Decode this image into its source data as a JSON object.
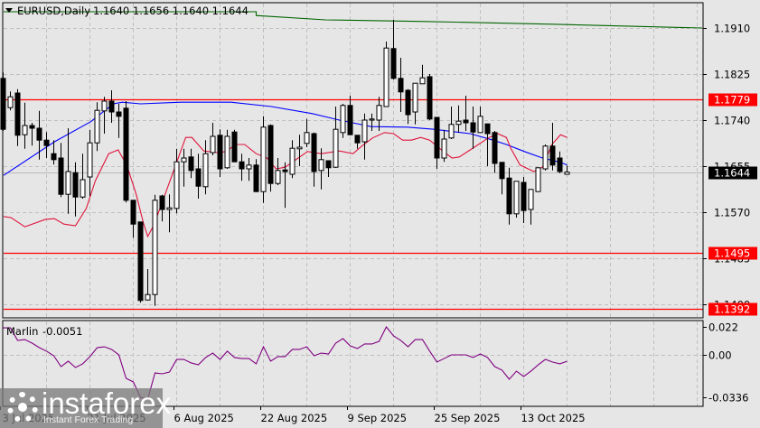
{
  "header": {
    "symbol_timeframe": "EURUSD,Daily",
    "ohlc": "1.1640 1.1656 1.1640 1.1644"
  },
  "price_axis": {
    "ticks": [
      "1.1910",
      "1.1825",
      "1.1740",
      "1.1655",
      "1.1570",
      "1.1485",
      "1.1400"
    ],
    "tick_values": [
      1.191,
      1.1825,
      1.174,
      1.1655,
      1.157,
      1.1485,
      1.14
    ]
  },
  "levels": [
    {
      "label": "1.1779",
      "value": 1.1779,
      "color": "#ff0000"
    },
    {
      "label": "1.1495",
      "value": 1.1495,
      "color": "#ff0000"
    },
    {
      "label": "1.1392",
      "value": 1.1392,
      "color": "#ff0000"
    }
  ],
  "current_price": {
    "label": "1.1644",
    "value": 1.1644
  },
  "date_axis": {
    "labels": [
      "3 Jul 2025",
      "21 Jul 2025",
      "6 Aug 2025",
      "22 Aug 2025",
      "9 Sep 2025",
      "25 Sep 2025",
      "13 Oct 2025"
    ],
    "label_bars": [
      0,
      12,
      24,
      36,
      48,
      60,
      72
    ]
  },
  "indicator": {
    "name": "Marlin",
    "value_label": "-0.0051",
    "ticks": [
      "0.022",
      "0.00",
      "-0.0336"
    ],
    "tick_values": [
      0.022,
      0,
      -0.0336
    ],
    "color": "#800080",
    "values": [
      0.0214,
      0.0214,
      0.0114,
      0.0121,
      0.0093,
      0.0057,
      0.0029,
      -0.0007,
      -0.0093,
      -0.005,
      -0.01,
      -0.0071,
      -0.0014,
      0.0057,
      0.0064,
      0.0043,
      0,
      -0.0186,
      -0.0214,
      -0.0336,
      -0.035,
      -0.0143,
      -0.015,
      -0.0136,
      -0.0036,
      -0.0036,
      -0.0064,
      -0.0079,
      -0.0021,
      0.0014,
      -0.0036,
      0.0029,
      -0.0021,
      -0.0029,
      -0.0029,
      -0.0071,
      0.0064,
      -0.005,
      -0.0014,
      -0.0014,
      0.0043,
      0.0043,
      0.0064,
      -0.0007,
      0.0014,
      0.0007,
      0.0093,
      0.0129,
      0.0071,
      0.005,
      0.0086,
      0.0086,
      0.0107,
      0.0221,
      0.015,
      0.0114,
      0.0064,
      0.0121,
      0.0121,
      0.0029,
      -0.0057,
      -0.0029,
      0,
      0,
      0,
      -0.0021,
      0.0007,
      -0.0021,
      -0.0093,
      -0.0121,
      -0.0193,
      -0.0129,
      -0.0171,
      -0.0129,
      -0.0079,
      -0.0036,
      -0.0057,
      -0.0071,
      -0.0051
    ]
  },
  "watermark": {
    "brand": "instaforex",
    "tagline": "Instant Forex Trading"
  },
  "colors": {
    "bg": "#e6e6e6",
    "grid": "#c0c0c0",
    "fast_ma": "#e0143c",
    "slow_ma": "#0000ff",
    "long_ma": "#006400",
    "level": "#ff0000"
  },
  "chart_data": {
    "type": "candlestick",
    "title": "EURUSD,Daily",
    "ylim": [
      1.138,
      1.1955
    ],
    "candles_ohlc": [
      [
        1.1817,
        1.1828,
        1.172,
        1.1723
      ],
      [
        1.1763,
        1.1793,
        1.1758,
        1.1783
      ],
      [
        1.179,
        1.1797,
        1.1692,
        1.1712
      ],
      [
        1.1713,
        1.1772,
        1.1687,
        1.173
      ],
      [
        1.173,
        1.1735,
        1.1693,
        1.1725
      ],
      [
        1.1725,
        1.1757,
        1.1667,
        1.1703
      ],
      [
        1.1703,
        1.1718,
        1.167,
        1.1693
      ],
      [
        1.1678,
        1.1703,
        1.1658,
        1.1667
      ],
      [
        1.167,
        1.1698,
        1.1598,
        1.1603
      ],
      [
        1.1603,
        1.1725,
        1.1567,
        1.1645
      ],
      [
        1.1643,
        1.1662,
        1.1562,
        1.1598
      ],
      [
        1.1598,
        1.1678,
        1.1595,
        1.163
      ],
      [
        1.1635,
        1.1722,
        1.16,
        1.1698
      ],
      [
        1.1698,
        1.1773,
        1.1683,
        1.1758
      ],
      [
        1.1757,
        1.1783,
        1.1715,
        1.1775
      ],
      [
        1.1775,
        1.1795,
        1.1735,
        1.1755
      ],
      [
        1.1755,
        1.177,
        1.1707,
        1.1747
      ],
      [
        1.1762,
        1.1775,
        1.1588,
        1.1592
      ],
      [
        1.1592,
        1.1592,
        1.1523,
        1.1548
      ],
      [
        1.1552,
        1.1552,
        1.1403,
        1.1407
      ],
      [
        1.1408,
        1.1465,
        1.1407,
        1.1418
      ],
      [
        1.1418,
        1.1602,
        1.1397,
        1.1592
      ],
      [
        1.16,
        1.1602,
        1.1553,
        1.1575
      ],
      [
        1.1575,
        1.1603,
        1.1533,
        1.1578
      ],
      [
        1.1577,
        1.1687,
        1.1568,
        1.1663
      ],
      [
        1.1663,
        1.1687,
        1.1617,
        1.167
      ],
      [
        1.1672,
        1.1687,
        1.1633,
        1.1647
      ],
      [
        1.165,
        1.1678,
        1.1595,
        1.1618
      ],
      [
        1.1617,
        1.1703,
        1.1603,
        1.1678
      ],
      [
        1.168,
        1.1735,
        1.1675,
        1.171
      ],
      [
        1.1712,
        1.1723,
        1.1635,
        1.165
      ],
      [
        1.1652,
        1.1722,
        1.165,
        1.171
      ],
      [
        1.1718,
        1.1722,
        1.1663,
        1.1663
      ],
      [
        1.1663,
        1.1678,
        1.1628,
        1.165
      ],
      [
        1.165,
        1.167,
        1.1628,
        1.1657
      ],
      [
        1.1657,
        1.1668,
        1.1607,
        1.1608
      ],
      [
        1.1608,
        1.1747,
        1.1587,
        1.1727
      ],
      [
        1.173,
        1.1732,
        1.1608,
        1.1623
      ],
      [
        1.1623,
        1.167,
        1.162,
        1.1647
      ],
      [
        1.1648,
        1.1662,
        1.1578,
        1.1645
      ],
      [
        1.164,
        1.1703,
        1.1633,
        1.1688
      ],
      [
        1.1687,
        1.1713,
        1.1655,
        1.169
      ],
      [
        1.1697,
        1.1742,
        1.169,
        1.1717
      ],
      [
        1.1715,
        1.1717,
        1.1617,
        1.1645
      ],
      [
        1.1647,
        1.1688,
        1.1612,
        1.1667
      ],
      [
        1.1665,
        1.1665,
        1.1635,
        1.1652
      ],
      [
        1.1653,
        1.1765,
        1.1652,
        1.1723
      ],
      [
        1.1717,
        1.177,
        1.1707,
        1.1767
      ],
      [
        1.1767,
        1.1785,
        1.1712,
        1.1713
      ],
      [
        1.1712,
        1.1712,
        1.1687,
        1.1698
      ],
      [
        1.17,
        1.1752,
        1.1667,
        1.174
      ],
      [
        1.174,
        1.1752,
        1.172,
        1.1742
      ],
      [
        1.174,
        1.1783,
        1.172,
        1.1767
      ],
      [
        1.1765,
        1.1885,
        1.1765,
        1.1873
      ],
      [
        1.1872,
        1.1925,
        1.1815,
        1.1817
      ],
      [
        1.1817,
        1.1855,
        1.1755,
        1.1792
      ],
      [
        1.1795,
        1.1797,
        1.1733,
        1.175
      ],
      [
        1.1755,
        1.1808,
        1.1732,
        1.1808
      ],
      [
        1.1807,
        1.1842,
        1.1807,
        1.1818
      ],
      [
        1.182,
        1.1825,
        1.174,
        1.1742
      ],
      [
        1.1745,
        1.1745,
        1.165,
        1.167
      ],
      [
        1.167,
        1.1722,
        1.1663,
        1.1705
      ],
      [
        1.1707,
        1.1765,
        1.1705,
        1.1732
      ],
      [
        1.1732,
        1.1767,
        1.1717,
        1.1738
      ],
      [
        1.174,
        1.1785,
        1.172,
        1.1735
      ],
      [
        1.1735,
        1.1765,
        1.1687,
        1.1718
      ],
      [
        1.1717,
        1.1765,
        1.1717,
        1.1747
      ],
      [
        1.1733,
        1.1733,
        1.1655,
        1.1715
      ],
      [
        1.1717,
        1.172,
        1.1643,
        1.166
      ],
      [
        1.1662,
        1.1662,
        1.1603,
        1.1632
      ],
      [
        1.1633,
        1.1652,
        1.1547,
        1.1567
      ],
      [
        1.1567,
        1.1627,
        1.156,
        1.1627
      ],
      [
        1.1625,
        1.1635,
        1.155,
        1.1573
      ],
      [
        1.1575,
        1.1612,
        1.1547,
        1.1612
      ],
      [
        1.1608,
        1.1653,
        1.1608,
        1.1652
      ],
      [
        1.165,
        1.1695,
        1.1647,
        1.1692
      ],
      [
        1.1692,
        1.1735,
        1.1647,
        1.1657
      ],
      [
        1.167,
        1.1682,
        1.1642,
        1.1645
      ],
      [
        1.164,
        1.1656,
        1.164,
        1.1644
      ]
    ],
    "series": [
      {
        "name": "slow_ma",
        "color": "#0000ff",
        "points": [
          [
            0,
            1.1638
          ],
          [
            7.1,
            1.17
          ],
          [
            12.1,
            1.1737
          ],
          [
            15.25,
            1.177
          ],
          [
            16.5,
            1.1773
          ],
          [
            19,
            1.177
          ],
          [
            24.6,
            1.1773
          ],
          [
            31.5,
            1.1773
          ],
          [
            37.1,
            1.1765
          ],
          [
            42.75,
            1.1752
          ],
          [
            46.5,
            1.174
          ],
          [
            50.9,
            1.1728
          ],
          [
            55.9,
            1.1727
          ],
          [
            59.6,
            1.1723
          ],
          [
            64.6,
            1.1715
          ],
          [
            67.75,
            1.1703
          ],
          [
            69.6,
            1.1695
          ],
          [
            72.1,
            1.1682
          ],
          [
            74.6,
            1.167
          ],
          [
            77.1,
            1.1662
          ],
          [
            78,
            1.1657
          ]
        ]
      },
      {
        "name": "fast_ma",
        "color": "#e0143c",
        "points": [
          [
            0,
            1.1562
          ],
          [
            1.1,
            1.156
          ],
          [
            3,
            1.1543
          ],
          [
            5.9,
            1.1557
          ],
          [
            7.1,
            1.1558
          ],
          [
            8.4,
            1.1548
          ],
          [
            10,
            1.1545
          ],
          [
            11.5,
            1.1577
          ],
          [
            12.75,
            1.1628
          ],
          [
            14.6,
            1.1678
          ],
          [
            15.9,
            1.1685
          ],
          [
            17.1,
            1.1657
          ],
          [
            18.4,
            1.1603
          ],
          [
            19.4,
            1.155
          ],
          [
            20,
            1.1525
          ],
          [
            20.9,
            1.1548
          ],
          [
            22.1,
            1.1592
          ],
          [
            24,
            1.1662
          ],
          [
            25.25,
            1.1708
          ],
          [
            26.1,
            1.1708
          ],
          [
            27.75,
            1.1683
          ],
          [
            29.6,
            1.168
          ],
          [
            30.9,
            1.1682
          ],
          [
            32.1,
            1.1695
          ],
          [
            33.4,
            1.1695
          ],
          [
            35,
            1.1678
          ],
          [
            36.5,
            1.167
          ],
          [
            37.75,
            1.165
          ],
          [
            39,
            1.1653
          ],
          [
            42.1,
            1.1682
          ],
          [
            44,
            1.1678
          ],
          [
            46.5,
            1.1683
          ],
          [
            48.4,
            1.1678
          ],
          [
            49.6,
            1.1692
          ],
          [
            51.1,
            1.1707
          ],
          [
            52.75,
            1.1717
          ],
          [
            54,
            1.1715
          ],
          [
            55.25,
            1.1703
          ],
          [
            56.5,
            1.1703
          ],
          [
            57.75,
            1.1708
          ],
          [
            59,
            1.1703
          ],
          [
            60.9,
            1.1682
          ],
          [
            62.1,
            1.167
          ],
          [
            63.1,
            1.1672
          ],
          [
            64.6,
            1.1685
          ],
          [
            67.1,
            1.1707
          ],
          [
            68.4,
            1.1715
          ],
          [
            69.6,
            1.1708
          ],
          [
            70.25,
            1.1687
          ],
          [
            71.5,
            1.1657
          ],
          [
            73.4,
            1.1645
          ],
          [
            74.6,
            1.1653
          ],
          [
            75.9,
            1.1695
          ],
          [
            77.1,
            1.1713
          ],
          [
            78,
            1.1708
          ]
        ]
      },
      {
        "name": "long_ma",
        "color": "#006400",
        "points": [
          [
            -0.4,
            1.194
          ],
          [
            35,
            1.194
          ],
          [
            35,
            1.1933
          ],
          [
            44.6,
            1.1925
          ],
          [
            58.4,
            1.1922
          ],
          [
            75.9,
            1.1917
          ],
          [
            96.9,
            1.191
          ]
        ]
      }
    ]
  }
}
